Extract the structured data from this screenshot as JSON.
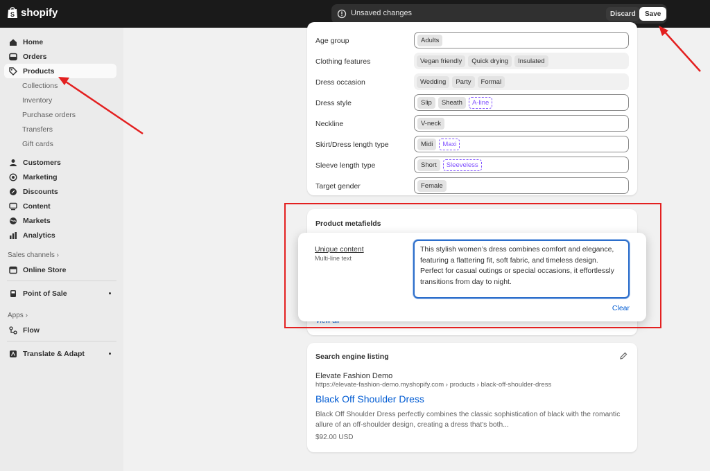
{
  "topbar": {
    "logo_text": "shopify",
    "unsaved_text": "Unsaved changes",
    "discard_label": "Discard",
    "save_label": "Save"
  },
  "sidebar": {
    "main_items": [
      {
        "label": "Home",
        "icon": "home-icon"
      },
      {
        "label": "Orders",
        "icon": "inbox-icon"
      },
      {
        "label": "Products",
        "icon": "tag-icon",
        "active": true
      }
    ],
    "product_sub_items": [
      "Collections",
      "Inventory",
      "Purchase orders",
      "Transfers",
      "Gift cards"
    ],
    "other_items": [
      {
        "label": "Customers",
        "icon": "person-icon"
      },
      {
        "label": "Marketing",
        "icon": "target-icon"
      },
      {
        "label": "Discounts",
        "icon": "discount-icon"
      },
      {
        "label": "Content",
        "icon": "content-icon"
      },
      {
        "label": "Markets",
        "icon": "globe-icon"
      },
      {
        "label": "Analytics",
        "icon": "chart-icon"
      }
    ],
    "sales_channels_label": "Sales channels",
    "online_store": "Online Store",
    "point_of_sale": "Point of Sale",
    "apps_label": "Apps",
    "flow": "Flow",
    "translate": "Translate & Adapt"
  },
  "attributes": [
    {
      "label": "Age group",
      "values": [
        "Adults"
      ],
      "suggested": [],
      "style": "outlined"
    },
    {
      "label": "Clothing features",
      "values": [
        "Vegan friendly",
        "Quick drying",
        "Insulated"
      ],
      "suggested": [],
      "style": "grey"
    },
    {
      "label": "Dress occasion",
      "values": [
        "Wedding",
        "Party",
        "Formal"
      ],
      "suggested": [],
      "style": "grey"
    },
    {
      "label": "Dress style",
      "values": [
        "Slip",
        "Sheath"
      ],
      "suggested": [
        "A-line"
      ],
      "style": "outlined"
    },
    {
      "label": "Neckline",
      "values": [
        "V-neck"
      ],
      "suggested": [],
      "style": "outlined"
    },
    {
      "label": "Skirt/Dress length type",
      "values": [
        "Midi"
      ],
      "suggested": [
        "Maxi"
      ],
      "style": "outlined"
    },
    {
      "label": "Sleeve length type",
      "values": [
        "Short"
      ],
      "suggested": [
        "Sleeveless"
      ],
      "style": "outlined"
    },
    {
      "label": "Target gender",
      "values": [
        "Female"
      ],
      "suggested": [],
      "style": "outlined"
    }
  ],
  "metafields": {
    "title": "Product metafields",
    "view_all": "View all",
    "field_label": "Unique content",
    "field_type": "Multi-line text",
    "field_value": "This stylish women’s dress combines comfort and elegance, featuring a flattering fit, soft fabric, and timeless design. Perfect for casual outings or special occasions, it effortlessly transitions from day to night.",
    "clear_label": "Clear"
  },
  "seo": {
    "title": "Search engine listing",
    "site_name": "Elevate Fashion Demo",
    "url": "https://elevate-fashion-demo.myshopify.com › products › black-off-shoulder-dress",
    "page_title": "Black Off Shoulder Dress",
    "description": "Black Off Shoulder Dress perfectly combines the classic sophistication of black with the romantic allure of an off-shoulder design, creating a dress that's both...",
    "price": "$92.00 USD"
  },
  "colors": {
    "annotation_red": "#e32020",
    "link_blue": "#005bd3",
    "suggested_purple": "#8051ff",
    "topbar_bg": "#1a1a1a"
  }
}
